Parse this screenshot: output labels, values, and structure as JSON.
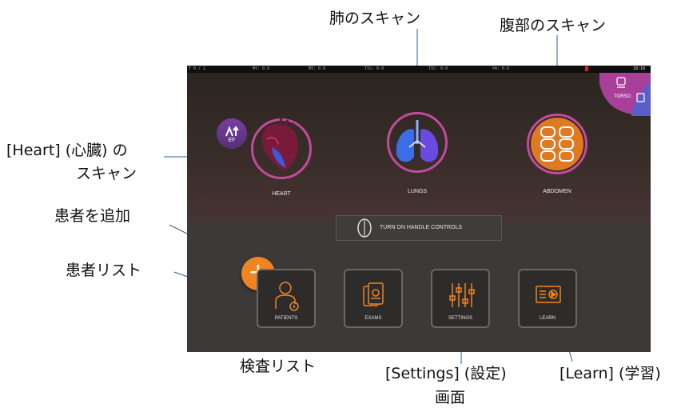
{
  "callouts": {
    "lungs_scan": "肺のスキャン",
    "abdomen_scan": "腹部のスキャン",
    "heart_scan_line1": "[Heart] (心臓) の",
    "heart_scan_line2": "スキャン",
    "add_patient": "患者を追加",
    "patient_list": "患者リスト",
    "exam_list": "検査リスト",
    "settings_line1": "[Settings] (設定)",
    "settings_line2": "画面",
    "learn": "[Learn] (学習)"
  },
  "status_bar": {
    "items": [
      "F 0 / 1",
      "Mt: 0.0",
      "MI: 0.0",
      "TIs: 0.0",
      "TIC: 0.0",
      "Pm: 0.0"
    ],
    "time": "18:18"
  },
  "presets": {
    "torso_label": "TORSO"
  },
  "scans": {
    "heart": {
      "label": "HEART",
      "badge": "EF"
    },
    "lungs": {
      "label": "LUNGS"
    },
    "abdomen": {
      "label": "ABDOMEN"
    }
  },
  "handle_controls": {
    "label": "TURN ON HANDLE CONTROLS"
  },
  "add_button": {
    "symbol": "+"
  },
  "tiles": {
    "patients": "PATIENTS",
    "exams": "EXAMS",
    "settings": "SETTINGS",
    "learn": "LEARN"
  },
  "colors": {
    "accent_orange": "#f08422",
    "ring_magenta": "#c34a9e",
    "organ_blue": "#3a6ee8"
  }
}
